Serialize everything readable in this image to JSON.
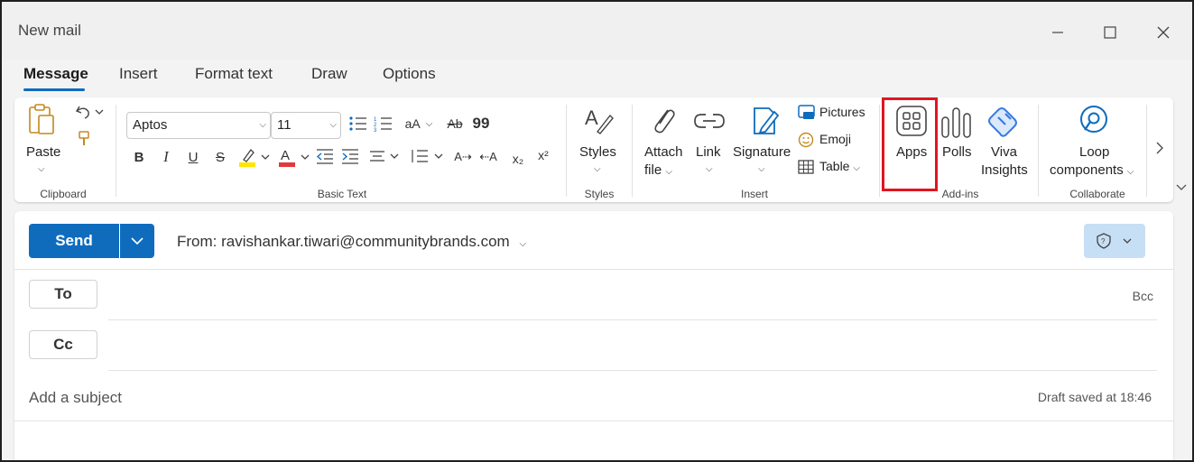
{
  "window": {
    "title": "New mail"
  },
  "tabs": [
    "Message",
    "Insert",
    "Format text",
    "Draw",
    "Options"
  ],
  "ribbon": {
    "clipboard": {
      "paste_label": "Paste",
      "group_label": "Clipboard"
    },
    "basic_text": {
      "font_name": "Aptos",
      "font_size": "11",
      "group_label": "Basic Text",
      "bold": "B",
      "italic": "I",
      "underline": "U",
      "strike": "S",
      "subscript": "x₂",
      "superscript": "x²"
    },
    "styles": {
      "label": "Styles",
      "group_label": "Styles"
    },
    "insert": {
      "attach_label_1": "Attach",
      "attach_label_2": "file",
      "link_label": "Link",
      "signature_label": "Signature",
      "pictures_label": "Pictures",
      "emoji_label": "Emoji",
      "table_label": "Table",
      "group_label": "Insert"
    },
    "addins": {
      "apps_label": "Apps",
      "polls_label": "Polls",
      "viva_label_1": "Viva",
      "viva_label_2": "Insights",
      "group_label": "Add-ins"
    },
    "collaborate": {
      "loop_label_1": "Loop",
      "loop_label_2": "components",
      "group_label": "Collaborate"
    }
  },
  "compose": {
    "send_label": "Send",
    "from_text": "From: ravishankar.tiwari@communitybrands.com",
    "to_label": "To",
    "cc_label": "Cc",
    "bcc_label": "Bcc",
    "subject_placeholder": "Add a subject",
    "draft_status": "Draft saved at 18:46"
  },
  "colors": {
    "accent": "#0f6cbd",
    "highlight_box": "#e0161f",
    "highlighter": "#ffe600",
    "font_color": "#e03a3a"
  }
}
